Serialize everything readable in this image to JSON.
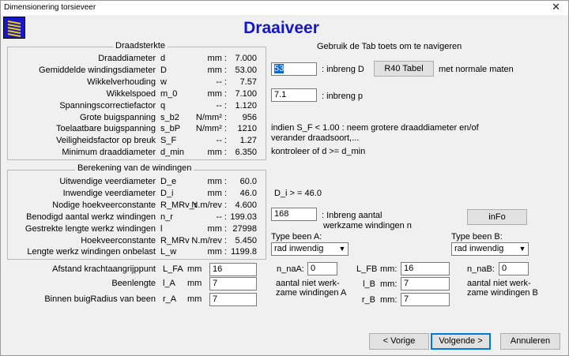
{
  "window": {
    "title": "Dimensionering torsieveer",
    "close": "✕"
  },
  "icon": "spring-icon",
  "app_title": "Draaiveer",
  "tab_hint": "Gebruik de Tab toets om te navigeren",
  "draadsterkte": {
    "title": "Draadsterkte",
    "rows": [
      {
        "label": "Draaddiameter",
        "sym": "d",
        "unit": "mm :",
        "value": "7.000"
      },
      {
        "label": "Gemiddelde windingsdiameter",
        "sym": "D",
        "unit": "mm :",
        "value": "53.00"
      },
      {
        "label": "Wikkelverhouding",
        "sym": "w",
        "unit": "-- :",
        "value": "7.57"
      },
      {
        "label": "Wikkelspoed",
        "sym": "m_0",
        "unit": "mm :",
        "value": "7.100"
      },
      {
        "label": "Spanningscorrectiefactor",
        "sym": "q",
        "unit": "-- :",
        "value": "1.120"
      },
      {
        "label": "Grote buigspanning",
        "sym": "s_b2",
        "unit": "N/mm² :",
        "value": "956"
      },
      {
        "label": "Toelaatbare buigspanning",
        "sym": "s_bP",
        "unit": "N/mm² :",
        "value": "1210"
      },
      {
        "label": "Veiligheidsfactor op breuk",
        "sym": "S_F",
        "unit": "-- :",
        "value": "1.27"
      },
      {
        "label": "Minimum draaddiameter",
        "sym": "d_min",
        "unit": "mm :",
        "value": "6.350"
      }
    ]
  },
  "windingen": {
    "title": "Berekening van de windingen",
    "rows": [
      {
        "label": "Uitwendige veerdiameter",
        "sym": "D_e",
        "unit": "mm :",
        "value": "60.0"
      },
      {
        "label": "Inwendige veerdiameter",
        "sym": "D_i",
        "unit": "mm :",
        "value": "46.0"
      },
      {
        "label": "Nodige hoekveerconstante",
        "sym": "R_MRv_r",
        "unit": "N.m/rev :",
        "value": "4.600"
      },
      {
        "label": "Benodigd aantal werkz windingen",
        "sym": "n_r",
        "unit": "-- :",
        "value": "199.03"
      },
      {
        "label": "Gestrekte lengte werkz windingen",
        "sym": "l",
        "unit": "mm :",
        "value": "27998"
      },
      {
        "label": "Hoekveerconstante",
        "sym": "R_MRv",
        "unit": "N.m/rev :",
        "value": "5.450"
      },
      {
        "label": "Lengte werkz windingen onbelast",
        "sym": "L_w",
        "unit": "mm :",
        "value": "1199.8"
      }
    ]
  },
  "inputs": {
    "D": {
      "value": "53",
      "label": ": inbreng D"
    },
    "r40_button": "R40 Tabel",
    "r40_hint": "met normale maten",
    "p": {
      "value": "7.1",
      "label": ": inbreng p"
    },
    "warning_line1": "indien S_F < 1.00 : neem grotere draaddiameter  en/of",
    "warning_line2": "verander draadsoort,...",
    "dmin_hint": "kontroleer of d >= d_min",
    "di_hint": "D_i > = 46.0",
    "n": {
      "value": "168",
      "label_line1": ": Inbreng aantal",
      "label_line2": "werkzame windingen  n"
    },
    "info_button": "inFo"
  },
  "been_a": {
    "type_label": "Type been A:",
    "type_value": "rad inwendig",
    "rows": [
      {
        "label": "Afstand krachtaangrijppunt",
        "sym": "L_FA",
        "unit": "mm",
        "value": "16"
      },
      {
        "label": "Beenlengte",
        "sym": "l_A",
        "unit": "mm",
        "value": "7"
      },
      {
        "label": "Binnen buigRadius van been",
        "sym": "r_A",
        "unit": "mm",
        "value": "7"
      }
    ],
    "n_na_label": "n_naA:",
    "n_na_value": "0",
    "n_na_desc1": "aantal niet werk-",
    "n_na_desc2": "zame windingen A"
  },
  "been_b": {
    "type_label": "Type been B:",
    "type_value": "rad inwendig",
    "rows": [
      {
        "sym": "L_FB",
        "unit": "mm:",
        "value": "16"
      },
      {
        "sym": "l_B",
        "unit": "mm:",
        "value": "7"
      },
      {
        "sym": "r_B",
        "unit": "mm:",
        "value": "7"
      }
    ],
    "n_na_label": "n_naB:",
    "n_na_value": "0",
    "n_na_desc1": "aantal niet werk-",
    "n_na_desc2": "zame windingen B"
  },
  "footer": {
    "prev": "< Vorige",
    "next": "Volgende >",
    "cancel": "Annuleren"
  }
}
